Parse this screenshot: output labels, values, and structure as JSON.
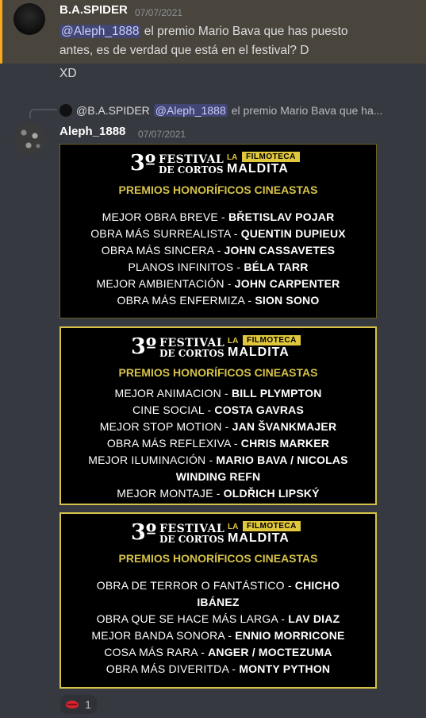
{
  "message1": {
    "author": "B.A.SPIDER",
    "timestamp": "07/07/2021",
    "mention": "@Aleph_1888",
    "text_line1": " el premio Mario Bava que has puesto",
    "text_line2": "antes, es de verdad que está en el festival? D",
    "text_line3": "XD"
  },
  "reply": {
    "author": "@B.A.SPIDER",
    "mention": "@Aleph_1888",
    "snippet": "el premio Mario Bava que ha..."
  },
  "message2": {
    "author": "Aleph_1888",
    "timestamp": "07/07/2021"
  },
  "poster_brand": {
    "number": "3º",
    "festival_line1": "FESTIVAL",
    "festival_line2": "DE CORTOS",
    "la": "LA",
    "filmoteca": "FILMOTECA",
    "maldita": "MALDITA",
    "heading": "PREMIOS HONORÍFICOS CINEASTAS"
  },
  "posters": [
    {
      "awards": [
        {
          "category": "MEJOR OBRA BREVE - ",
          "winner": "BŘETISLAV POJAR"
        },
        {
          "category": "OBRA MÁS SURREALISTA - ",
          "winner": "QUENTIN DUPIEUX"
        },
        {
          "category": "OBRA MÁS SINCERA - ",
          "winner": "JOHN CASSAVETES"
        },
        {
          "category": "PLANOS INFINITOS - ",
          "winner": "BÉLA TARR"
        },
        {
          "category": "MEJOR AMBIENTACIÓN - ",
          "winner": "JOHN CARPENTER"
        },
        {
          "category": "OBRA MÁS ENFERMIZA - ",
          "winner": "SION SONO"
        }
      ]
    },
    {
      "awards": [
        {
          "category": "MEJOR ANIMACION - ",
          "winner": "BILL PLYMPTON"
        },
        {
          "category": "CINE SOCIAL - ",
          "winner": "COSTA GAVRAS"
        },
        {
          "category": "MEJOR STOP MOTION - ",
          "winner": "JAN ŠVANKMAJER"
        },
        {
          "category": "OBRA MÁS REFLEXIVA - ",
          "winner": "CHRIS MARKER"
        },
        {
          "category": "MEJOR ILUMINACIÓN - ",
          "winner": "MARIO BAVA / NICOLAS"
        },
        {
          "category": "",
          "winner": "WINDING REFN"
        },
        {
          "category": "MEJOR MONTAJE - ",
          "winner": "OLDŘICH LIPSKÝ"
        }
      ]
    },
    {
      "awards": [
        {
          "category": "OBRA DE TERROR O FANTÁSTICO - ",
          "winner": "CHICHO"
        },
        {
          "category": "",
          "winner": "IBÁNEZ"
        },
        {
          "category": "OBRA QUE SE HACE MÁS LARGA - ",
          "winner": "LAV DIAZ"
        },
        {
          "category": "MEJOR BANDA SONORA - ",
          "winner": "ENNIO MORRICONE"
        },
        {
          "category": "COSA MÁS RARA - ",
          "winner": "ANGER / MOCTEZUMA"
        },
        {
          "category": "OBRA MÁS DIVERITDA - ",
          "winner": "MONTY PYTHON"
        }
      ]
    }
  ],
  "reaction": {
    "icon": "kiss-lips-icon",
    "count": "1"
  }
}
